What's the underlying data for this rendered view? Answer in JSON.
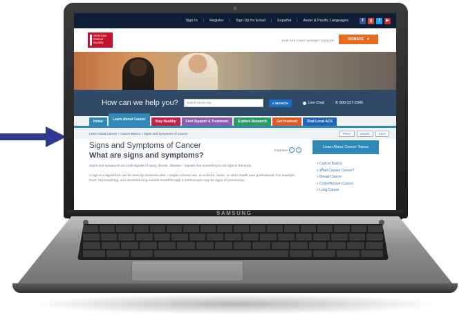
{
  "device": {
    "brand": "SAMSUNG"
  },
  "site": {
    "topbar": [
      "Sign In",
      "Register",
      "Sign Up for Email",
      "Español",
      "Asian & Pacific Languages"
    ],
    "social_icons": [
      "facebook-icon",
      "google-plus-icon",
      "twitter-icon",
      "youtube-icon"
    ],
    "logo_text": "American Cancer Society",
    "tagline": "JOIN THE FIGHT AGAINST CANCER",
    "donate_label": "DONATE",
    "search": {
      "prompt": "How can we help you?",
      "placeholder": "search cancer.org",
      "button": "SEARCH",
      "live_chat": "Live Chat",
      "phone": "800-227-2345"
    },
    "nav": [
      {
        "label": "Home",
        "color": "#2e88b8"
      },
      {
        "label": "Learn About Cancer",
        "color": "#2e88b8",
        "active": true
      },
      {
        "label": "Stay Healthy",
        "color": "#c4224a"
      },
      {
        "label": "Find Support & Treatment",
        "color": "#8a5cab"
      },
      {
        "label": "Explore Research",
        "color": "#2f9a62"
      },
      {
        "label": "Get Involved",
        "color": "#e05a25"
      },
      {
        "label": "Find Local ACS",
        "color": "#2563b8"
      }
    ],
    "breadcrumb": "Learn About Cancer » Cancer Basics » Signs and Symptoms of Cancer",
    "tools": [
      "PRINT",
      "SHARE",
      "SAVE"
    ],
    "page_title": "Signs and Symptoms of Cancer",
    "font_size_label": "Font Size",
    "subtitle": "What are signs and symptoms?",
    "paragraphs": [
      "Signs and symptoms are both signals of injury, illness, disease – signals that something is not right in the body.",
      "A sign is a signal that can be seen by someone else – maybe a loved one, or a doctor, nurse, or other health care professional. For example, fever, fast breathing, and abnormal lung sounds heard through a stethoscope may be signs of pneumonia."
    ],
    "sidebar": {
      "heading": "Learn About Cancer Topics",
      "items": [
        "Cancer Basics",
        "What Causes Cancer?",
        "Breast Cancer",
        "Colon/Rectum Cancer",
        "Lung Cancer"
      ]
    }
  },
  "colors": {
    "accent": "#2e88b8",
    "donate": "#e86b20",
    "topbar": "#0f1c36",
    "arrow": "#2b3a8f"
  }
}
